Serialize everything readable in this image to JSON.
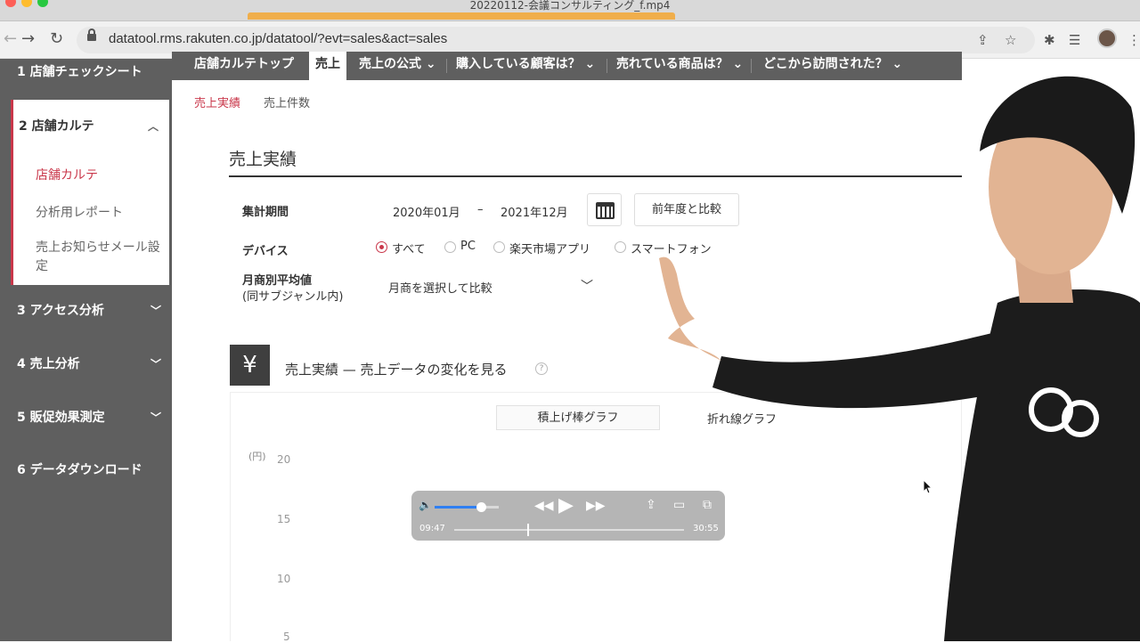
{
  "window": {
    "title": "20220112-会議コンサルティング_f.mp4"
  },
  "browser": {
    "url": "datatool.rms.rakuten.co.jp/datatool/?evt=sales&act=sales"
  },
  "sidebar": {
    "item1": "1  店舗チェックシート",
    "item2": "2  店舗カルテ",
    "sub_items": [
      "店舗カルテ",
      "分析用レポート",
      "売上お知らせメール設",
      "定"
    ],
    "item3": "3  アクセス分析",
    "item4": "4  売上分析",
    "item5": "5  販促効果測定",
    "item6": "6  データダウンロード"
  },
  "nav": {
    "items": [
      "店舗カルテトップ",
      "売上",
      "売上の公式 ⌄",
      "購入している顧客は？ ⌄",
      "売れている商品は？ ⌄",
      "どこから訪問された？ ⌄"
    ]
  },
  "subtabs": {
    "active": "売上実績",
    "other": "売上件数"
  },
  "section": {
    "title": "売上実績"
  },
  "filters": {
    "period_label": "集計期間",
    "period_start": "2020年01月",
    "period_sep": "–",
    "period_end": "2021年12月",
    "compare_label": "前年度と比較",
    "device_label": "デバイス",
    "device_options": [
      "すべて",
      "PC",
      "楽天市場アプリ",
      "スマートフォン"
    ],
    "device_selected": "すべて",
    "avg_label": "月商別平均値",
    "avg_sub": "(同サブジャンル内)",
    "avg_placeholder": "月商を選択して比較"
  },
  "chart_section": {
    "icon": "¥",
    "title": "売上実績 — 売上データの変化を見る",
    "help": "?",
    "toggle_stacked": "積上げ棒グラフ",
    "toggle_line": "折れ線グラフ",
    "unit": "(円)",
    "y_ticks": [
      "20",
      "15",
      "10",
      "5"
    ]
  },
  "video": {
    "elapsed": "09:47",
    "total": "30:55",
    "progress": 0.317,
    "volume": 0.72
  },
  "colors": {
    "accent": "#c9374a",
    "sidebar": "#5f5f5f",
    "player_blue": "#2f7ff2"
  }
}
